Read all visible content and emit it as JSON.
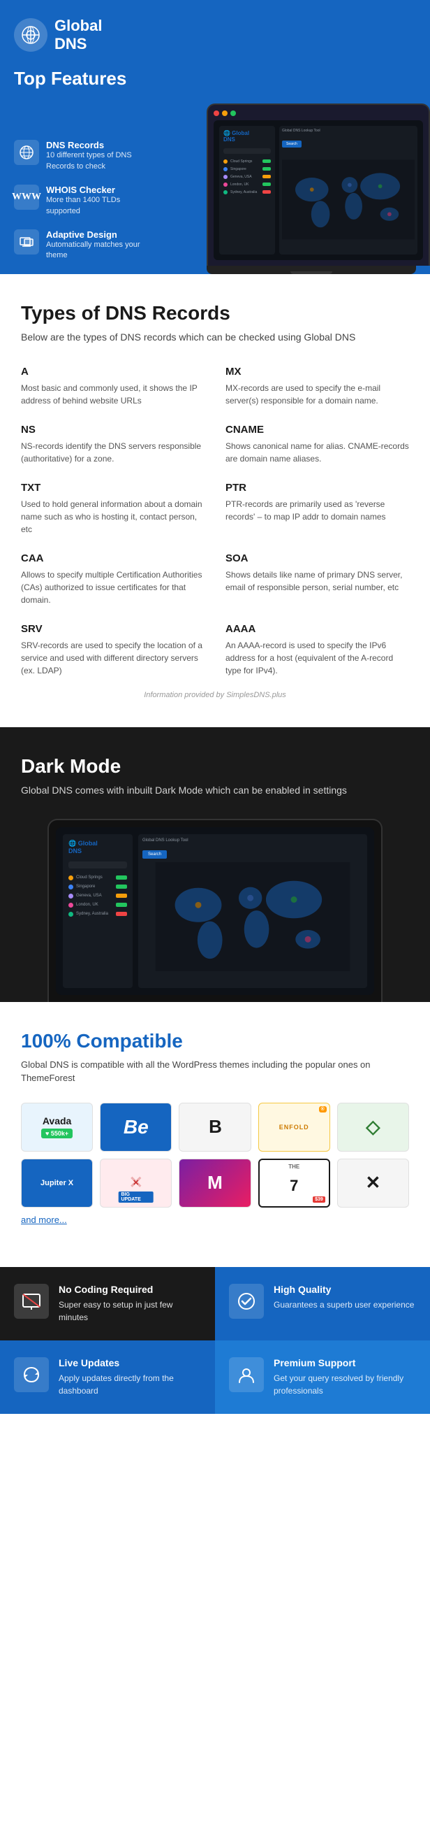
{
  "hero": {
    "logo_line1": "Global",
    "logo_line2": "DNS",
    "title": "Top Features",
    "features": [
      {
        "icon": "🌐",
        "name": "DNS Records",
        "desc": "10 different types of DNS Records to check"
      },
      {
        "icon": "W",
        "name": "WHOIS Checker",
        "desc": "More than 1400 TLDs supported"
      },
      {
        "icon": "✏",
        "name": "Adaptive Design",
        "desc": "Automatically matches your theme"
      }
    ]
  },
  "dns_section": {
    "title": "Types of DNS Records",
    "subtitle": "Below are the types of DNS records which can be checked using Global DNS",
    "records": [
      {
        "type": "A",
        "desc": "Most basic and commonly used, it shows the IP address of behind website URLs"
      },
      {
        "type": "MX",
        "desc": "MX-records are used to specify the e-mail server(s) responsible for a domain name."
      },
      {
        "type": "NS",
        "desc": "NS-records identify the DNS servers responsible (authoritative) for a zone."
      },
      {
        "type": "CNAME",
        "desc": "Shows canonical name for alias. CNAME-records are domain name aliases."
      },
      {
        "type": "TXT",
        "desc": "Used to hold general information about a domain name such as who is hosting it, contact person, etc"
      },
      {
        "type": "PTR",
        "desc": "PTR-records are primarily used as 'reverse records' – to map IP addr to domain names"
      },
      {
        "type": "CAA",
        "desc": "Allows to specify multiple Certification Authorities (CAs) authorized to issue certificates for that domain."
      },
      {
        "type": "SOA",
        "desc": "Shows details like name of primary DNS server, email of responsible person, serial number, etc"
      },
      {
        "type": "SRV",
        "desc": "SRV-records are used to specify the location of a service and used with different directory servers (ex. LDAP)"
      },
      {
        "type": "AAAA",
        "desc": "An AAAA-record is used to specify the IPv6 address for a host (equivalent of the A-record type for IPv4)."
      }
    ],
    "info_note": "Information provided by SimplesDNS.plus"
  },
  "dark_section": {
    "title": "Dark Mode",
    "subtitle": "Global DNS comes with inbuilt Dark Mode which can be enabled in settings"
  },
  "compat_section": {
    "title": "100% Compatible",
    "subtitle": "Global DNS is compatible with all the WordPress themes including the popular ones on ThemeForest",
    "themes": [
      {
        "name": "Avada",
        "sub": "550k+",
        "color": "#e8f4fd",
        "text_color": "#1a1a1a"
      },
      {
        "name": "Be",
        "color": "#1565C0",
        "text_color": "#fff"
      },
      {
        "name": "B",
        "color": "#f5f5f5",
        "text_color": "#1a1a1a"
      },
      {
        "name": "ENFOLD",
        "color": "#fff8e1",
        "text_color": "#cc7a00"
      },
      {
        "name": "◇",
        "color": "#e8f5e9",
        "text_color": "#2e7d32"
      },
      {
        "name": "Jupiter X",
        "color": "#1565C0",
        "text_color": "#fff"
      },
      {
        "name": "X",
        "color": "#ffebee",
        "text_color": "#c62828"
      },
      {
        "name": "M",
        "color": "#7b1fa2",
        "text_color": "#fff"
      },
      {
        "name": "7",
        "color": "#fff",
        "text_color": "#1a1a1a",
        "badge": "$39",
        "badge_color": "#e53935"
      },
      {
        "name": "X",
        "color": "#f5f5f5",
        "text_color": "#1a1a1a"
      }
    ],
    "and_more": "and more..."
  },
  "features_bottom": [
    {
      "icon": "🚫",
      "title": "No Coding Required",
      "desc": "Super easy to setup in just few minutes",
      "bg": "#1a1a1a"
    },
    {
      "icon": "✓",
      "title": "High Quality",
      "desc": "Guarantees a superb user experience",
      "bg": "#1565C0"
    },
    {
      "icon": "⚡",
      "title": "Live Updates",
      "desc": "Apply updates directly from the dashboard",
      "bg": "#1565C0"
    },
    {
      "icon": "👤",
      "title": "Premium Support",
      "desc": "Get your query resolved by friendly professionals",
      "bg": "#1e7bd4"
    }
  ],
  "screen_rows": [
    {
      "dot": "#f59e0b",
      "label": "Cloud Springs",
      "tag": "#22c55e"
    },
    {
      "dot": "#3b82f6",
      "label": "Singapore",
      "tag": "#22c55e"
    },
    {
      "dot": "#a78bfa",
      "label": "Geneva, USA",
      "tag": "#f59e0b"
    },
    {
      "dot": "#ec4899",
      "label": "London, UK",
      "tag": "#22c55e"
    },
    {
      "dot": "#10b981",
      "label": "Sydney, Australia",
      "tag": "#ef4444"
    }
  ]
}
